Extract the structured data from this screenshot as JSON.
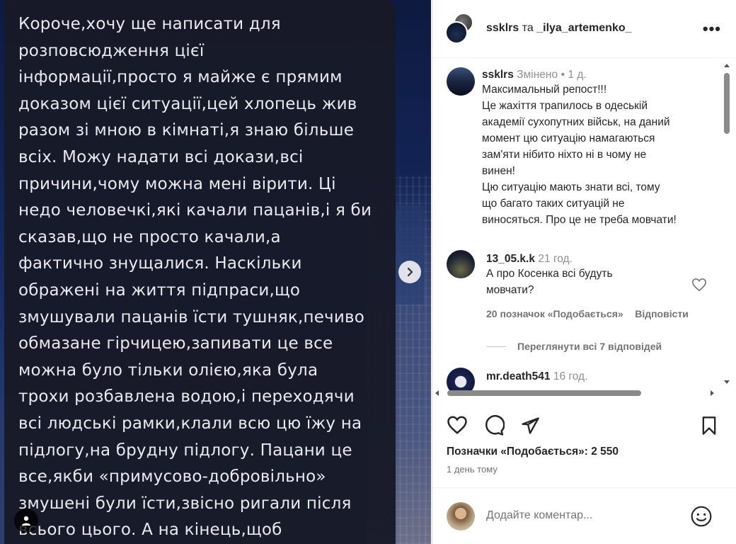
{
  "post_media": {
    "message_lines": [
      "Короче,хочу ще написати для",
      "розповсюдження цієї",
      "інформації,просто я майже є прямим",
      "доказом цієї ситуації,цей хлопець жив",
      "разом зі мною в кімнаті,я знаю більше",
      "всіх. Можу надати всі докази,всі",
      "причини,чому можна мені вірити. Ці",
      "недо человечкі,які качали пацанів,і я би",
      "сказав,що не просто качали,а",
      "фактично знущалися. Наскільки",
      "ображені на життя підпраси,що",
      "змушували пацанів їсти тушняк,печиво",
      "обмазане гірчицею,запивати це все",
      "можна було тільки олією,яка була",
      "трохи розбавлена водою,і переходячи",
      "всі людські рамки,клали всю цю їжу на",
      "підлогу,на брудну підлогу. Пацани це",
      "все,якби «примусово-добровільно»",
      "змушені були їсти,звісно ригали після",
      "всього цього. А на кінець,щоб"
    ]
  },
  "header": {
    "author": "ssklrs",
    "conjunction": "та",
    "coauthor": "_ilya_artemenko_"
  },
  "caption": {
    "username": "ssklrs",
    "edited": "Змінено",
    "dot": "•",
    "time": "1 д.",
    "lines": [
      "Максимальный репост!!!",
      "Це жахіття трапилось в одеській",
      "академії сухопутних військ, на даний",
      "момент цю ситуацію намагаються",
      "зам'яти нібито ніхто ні в чому не",
      "винен!",
      "Цю ситуацію мають знати всі, тому",
      "що багато таких ситуацій не",
      "виносяться. Про це не треба мовчати!"
    ]
  },
  "comments": [
    {
      "username": "13_05.k.k",
      "time": "21 год.",
      "text_lines": [
        "А про Косенка всі будуть",
        "мовчати?"
      ],
      "likes": "20 позначок «Подобається»",
      "reply": "Відповісти",
      "view_replies": "Переглянути всі 7 відповідей"
    },
    {
      "username": "mr.death541",
      "time": "16 год."
    }
  ],
  "actions": {
    "likes_label": "Позначки «Подобається»: 2 550",
    "time_ago": "1 день тому"
  },
  "add_comment": {
    "placeholder": "Додайте коментар..."
  },
  "colors": {
    "text": "#262626",
    "secondary": "#737373",
    "divider": "#efefef",
    "message_bg": "#181a28"
  }
}
